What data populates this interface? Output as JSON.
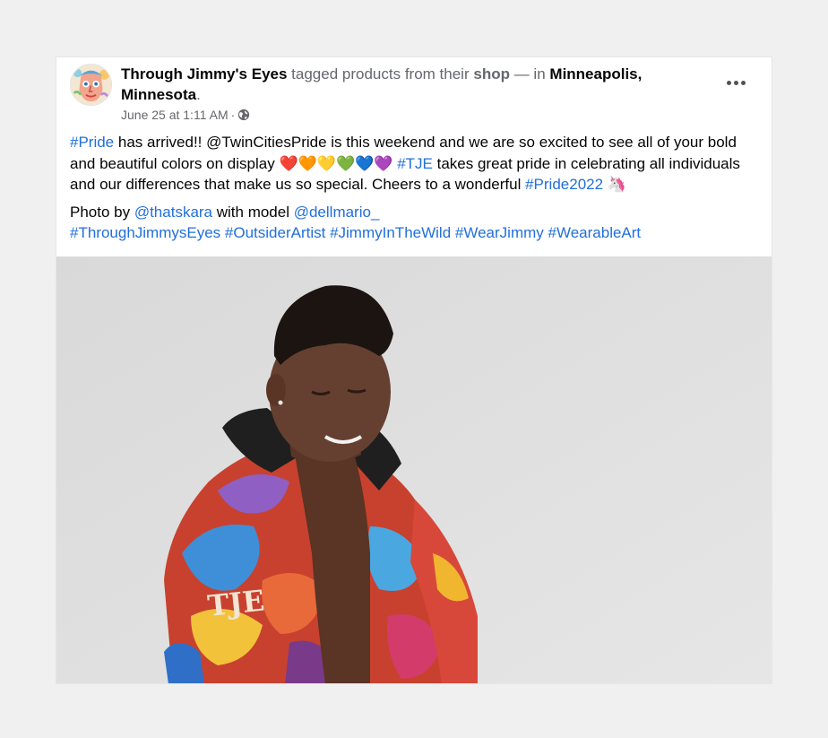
{
  "post": {
    "page_name": "Through Jimmy's Eyes",
    "tagged_text": "tagged products from their",
    "shop_label": "shop",
    "in_text": "— in",
    "location": "Minneapolis, Minnesota",
    "period": ".",
    "date": "June 25 at 1:11 AM",
    "separator": "·",
    "icons": {
      "avatar": "avatar-icon",
      "globe": "globe-icon",
      "more": "more-icon"
    },
    "paragraph1": {
      "tag_pride": "#Pride",
      "text1": " has arrived!! @TwinCitiesPride is this weekend and we are so excited to see all of your bold and beautiful colors on display ",
      "hearts": "❤️🧡💛💚💙💜",
      "tag_tje": "#TJE",
      "text2": " takes great pride in celebrating all individuals and our differences that make us so special. Cheers to a wonderful ",
      "tag_pride2022": "#Pride2022",
      "unicorn": "🦄"
    },
    "paragraph2": {
      "photo_by": "Photo by ",
      "photographer": "@thatskara",
      "with_model": " with model ",
      "model": "@dellmario_",
      "hashtags": [
        "#ThroughJimmysEyes",
        "#OutsiderArtist",
        "#JimmyInTheWild",
        "#WearJimmy",
        "#WearableArt"
      ]
    },
    "colors": {
      "link": "#216fdb",
      "secondary_text": "#65676b",
      "photo_background": "#dedede"
    }
  }
}
